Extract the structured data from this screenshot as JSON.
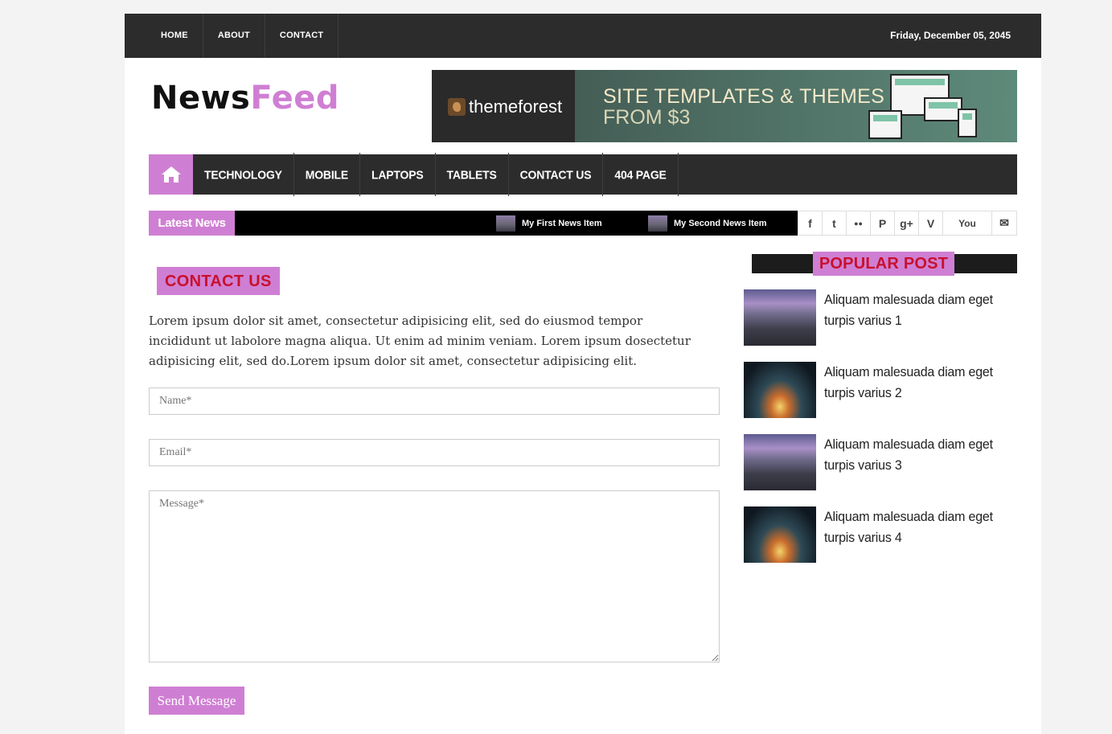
{
  "topbar": {
    "links": [
      "HOME",
      "ABOUT",
      "CONTACT"
    ],
    "date": "Friday, December 05, 2045"
  },
  "logo": {
    "part1": "News",
    "part2": "Feed"
  },
  "banner": {
    "brand": "themeforest",
    "line1": "SITE TEMPLATES & THEMES",
    "line2": "FROM $3"
  },
  "mainnav": {
    "home_icon": "home-icon",
    "items": [
      "TECHNOLOGY",
      "MOBILE",
      "LAPTOPS",
      "TABLETS",
      "CONTACT US",
      "404 PAGE"
    ]
  },
  "ticker": {
    "label": "Latest News",
    "items": [
      "My First News Item",
      "My Second News Item"
    ]
  },
  "social": {
    "icons": [
      "facebook-icon",
      "twitter-icon",
      "flickr-icon",
      "pinterest-icon",
      "google-plus-icon",
      "vimeo-icon",
      "youtube-icon",
      "mail-icon"
    ],
    "glyphs": [
      "f",
      "t",
      "●●",
      "P",
      "g+",
      "V",
      "You",
      "✉"
    ]
  },
  "contact": {
    "title": "CONTACT US",
    "intro": "Lorem ipsum dolor sit amet, consectetur adipisicing elit, sed do eiusmod tempor incididunt ut labolore magna aliqua. Ut enim ad minim veniam. Lorem ipsum dosectetur adipisicing elit, sed do.Lorem ipsum dolor sit amet, consectetur adipisicing elit.",
    "name_placeholder": "Name*",
    "email_placeholder": "Email*",
    "message_placeholder": "Message*",
    "send_label": "Send Message"
  },
  "sidebar": {
    "title": "POPULAR POST",
    "posts": [
      "Aliquam malesuada diam eget turpis varius 1",
      "Aliquam malesuada diam eget turpis varius 2",
      "Aliquam malesuada diam eget turpis varius 3",
      "Aliquam malesuada diam eget turpis varius 4"
    ]
  },
  "colors": {
    "accent": "#cf7fd3",
    "title_red": "#c8102e",
    "dark": "#2c2c2c"
  }
}
